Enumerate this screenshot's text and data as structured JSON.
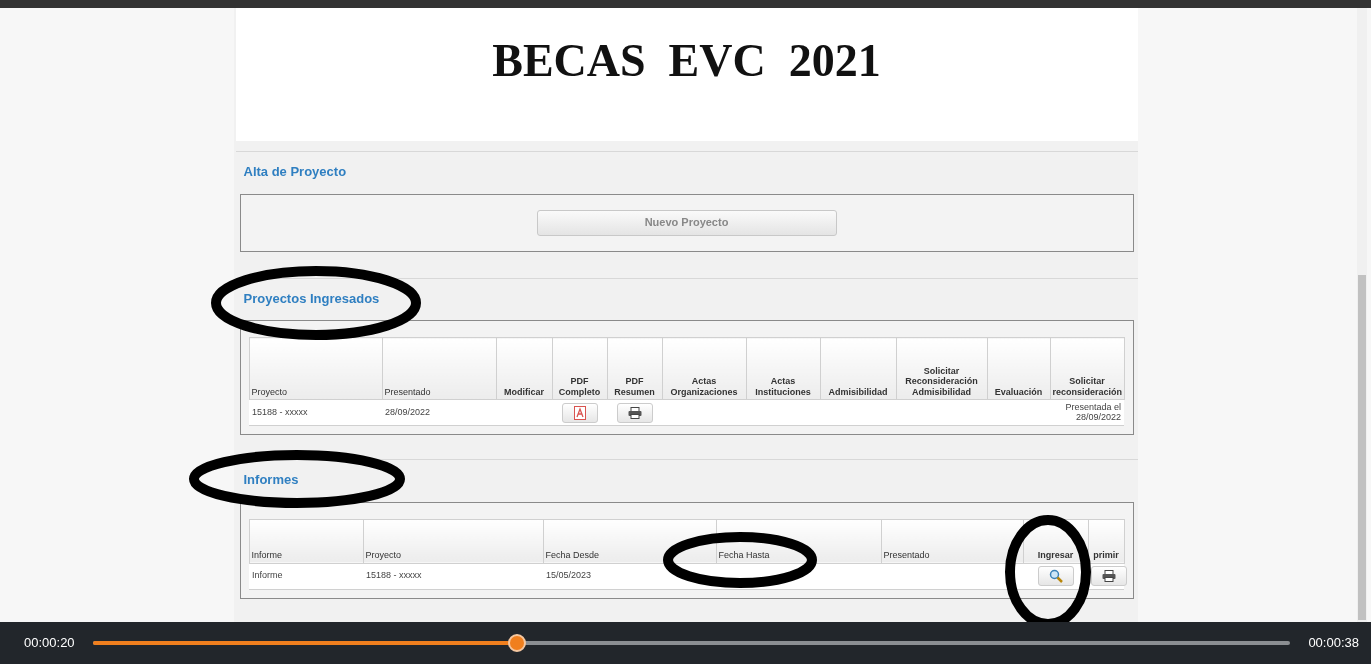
{
  "banner": {
    "title": "BECAS  EVC  2021"
  },
  "alta": {
    "heading": "Alta de Proyecto",
    "button": "Nuevo Proyecto"
  },
  "proyectos": {
    "heading": "Proyectos Ingresados",
    "columns": [
      {
        "label": "Proyecto",
        "kind": "data"
      },
      {
        "label": "Presentado",
        "kind": "data"
      },
      {
        "label": "Modificar",
        "kind": "action"
      },
      {
        "label": "PDF Completo",
        "kind": "action"
      },
      {
        "label": "PDF Resumen",
        "kind": "action"
      },
      {
        "label": "Actas Organizaciones",
        "kind": "action"
      },
      {
        "label": "Actas Instituciones",
        "kind": "action"
      },
      {
        "label": "Admisibilidad",
        "kind": "action"
      },
      {
        "label": "Solicitar Reconsideración Admisibilidad",
        "kind": "action"
      },
      {
        "label": "Evaluación",
        "kind": "action"
      },
      {
        "label": "Solicitar reconsideración",
        "kind": "action"
      }
    ],
    "rows": [
      [
        {
          "kind": "text",
          "text": "15188 - xxxxx"
        },
        {
          "kind": "text",
          "text": "28/09/2022"
        },
        {
          "kind": "empty"
        },
        {
          "kind": "pdf"
        },
        {
          "kind": "print"
        },
        {
          "kind": "empty"
        },
        {
          "kind": "empty"
        },
        {
          "kind": "empty"
        },
        {
          "kind": "empty"
        },
        {
          "kind": "empty"
        },
        {
          "kind": "text",
          "text": "Presentada el 28/09/2022"
        }
      ]
    ]
  },
  "informes": {
    "heading": "Informes",
    "columns": [
      {
        "label": "Informe",
        "kind": "data"
      },
      {
        "label": "Proyecto",
        "kind": "data"
      },
      {
        "label": "Fecha Desde",
        "kind": "data"
      },
      {
        "label": "Fecha Hasta",
        "kind": "data"
      },
      {
        "label": "Presentado",
        "kind": "data"
      },
      {
        "label": "Ingresar",
        "kind": "action"
      },
      {
        "label": "primir",
        "kind": "action"
      }
    ],
    "rows": [
      [
        {
          "kind": "text",
          "text": "Informe"
        },
        {
          "kind": "text",
          "text": "15188 - xxxxx"
        },
        {
          "kind": "text",
          "text": "15/05/2023"
        },
        {
          "kind": "empty"
        },
        {
          "kind": "empty"
        },
        {
          "kind": "search"
        },
        {
          "kind": "print"
        }
      ]
    ]
  },
  "player": {
    "elapsed": "00:00:20",
    "total": "00:00:38",
    "level": 0.354
  }
}
